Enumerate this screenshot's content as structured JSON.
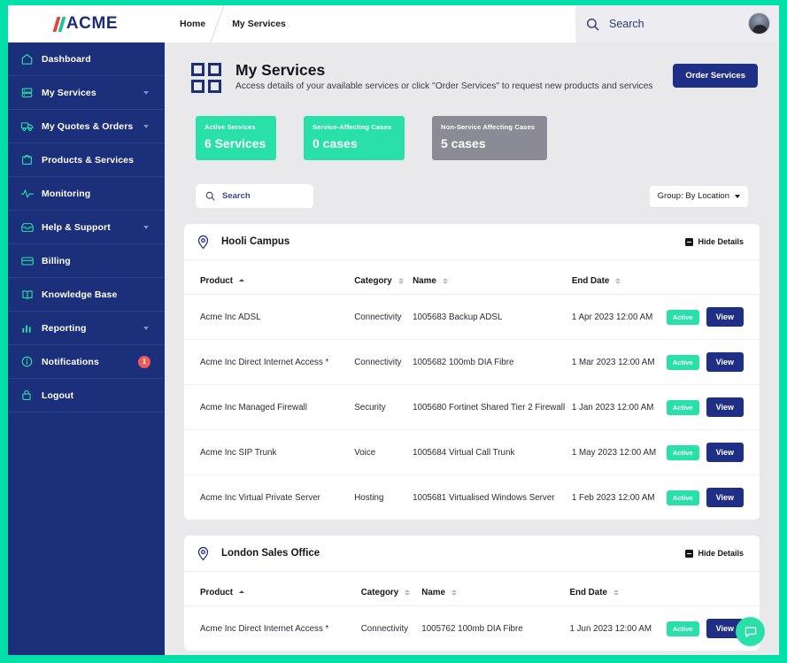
{
  "brand": {
    "logo_text": "ACME",
    "navy": "#1b2f7a",
    "teal": "#2ae0a9",
    "red": "#e8433f",
    "grey": "#8b8b96"
  },
  "topbar": {
    "breadcrumb": [
      "Home",
      "My Services"
    ],
    "search_label": "Search",
    "search_icon": "search-icon",
    "avatar_icon": "user-avatar"
  },
  "sidebar": {
    "items": [
      {
        "label": "Dashboard",
        "icon": "home-icon",
        "expandable": false,
        "badge": ""
      },
      {
        "label": "My Services",
        "icon": "server-icon",
        "expandable": true,
        "badge": ""
      },
      {
        "label": "My Quotes & Orders",
        "icon": "truck-icon",
        "expandable": true,
        "badge": ""
      },
      {
        "label": "Products & Services",
        "icon": "bag-icon",
        "expandable": false,
        "badge": ""
      },
      {
        "label": "Monitoring",
        "icon": "pulse-icon",
        "expandable": false,
        "badge": ""
      },
      {
        "label": "Help & Support",
        "icon": "inbox-icon",
        "expandable": true,
        "badge": ""
      },
      {
        "label": "Billing",
        "icon": "credit-card-icon",
        "expandable": false,
        "badge": ""
      },
      {
        "label": "Knowledge Base",
        "icon": "book-icon",
        "expandable": false,
        "badge": ""
      },
      {
        "label": "Reporting",
        "icon": "bar-chart-icon",
        "expandable": true,
        "badge": ""
      },
      {
        "label": "Notifications",
        "icon": "info-icon",
        "expandable": false,
        "badge": "1"
      },
      {
        "label": "Logout",
        "icon": "lock-icon",
        "expandable": false,
        "badge": ""
      }
    ]
  },
  "header": {
    "icon": "grid-icon",
    "title": "My Services",
    "subtitle": "Access details of your available services or click \"Order Services\" to request new products and services",
    "order_button": "Order Services"
  },
  "stats": [
    {
      "label": "Active Services",
      "value": "6 Services",
      "color": "teal"
    },
    {
      "label": "Service-Affecting Cases",
      "value": "0 cases",
      "color": "teal"
    },
    {
      "label": "Non-Service Affecting Cases",
      "value": "5 cases",
      "color": "grey"
    }
  ],
  "filters": {
    "search_placeholder": "Search",
    "search_value": "",
    "group_label": "Group: By Location"
  },
  "table_columns": [
    {
      "label": "Product",
      "sort": "asc"
    },
    {
      "label": "Category",
      "sort": "none"
    },
    {
      "label": "Name",
      "sort": "none"
    },
    {
      "label": "End Date",
      "sort": "none"
    }
  ],
  "hide_details_label": "Hide Details",
  "status_label": "Active",
  "view_label": "View",
  "locations": [
    {
      "name": "Hooli Campus",
      "rows": [
        {
          "product": "Acme Inc ADSL",
          "category": "Connectivity",
          "name": "1005683 Backup ADSL",
          "end_date": "1 Apr 2023 12:00 AM",
          "status": "Active",
          "action": "View"
        },
        {
          "product": "Acme Inc Direct Internet Access *",
          "category": "Connectivity",
          "name": "1005682 100mb DIA Fibre",
          "end_date": "1 Mar 2023 12:00 AM",
          "status": "Active",
          "action": "View"
        },
        {
          "product": "Acme Inc Managed Firewall",
          "category": "Security",
          "name": "1005680 Fortinet Shared Tier 2 Firewall",
          "end_date": "1 Jan 2023 12:00 AM",
          "status": "Active",
          "action": "View"
        },
        {
          "product": "Acme Inc SIP Trunk",
          "category": "Voice",
          "name": "1005684 Virtual Call Trunk",
          "end_date": "1 May 2023 12:00 AM",
          "status": "Active",
          "action": "View"
        },
        {
          "product": "Acme Inc Virtual Private Server",
          "category": "Hosting",
          "name": "1005681 Virtualised Windows Server",
          "end_date": "1 Feb 2023 12:00 AM",
          "status": "Active",
          "action": "View"
        }
      ]
    },
    {
      "name": "London Sales Office",
      "rows": [
        {
          "product": "Acme Inc Direct Internet Access *",
          "category": "Connectivity",
          "name": "1005762 100mb DIA Fibre",
          "end_date": "1 Jun 2023 12:00 AM",
          "status": "Active",
          "action": "View"
        }
      ]
    }
  ],
  "chat": {
    "icon": "chat-bubble-icon"
  }
}
